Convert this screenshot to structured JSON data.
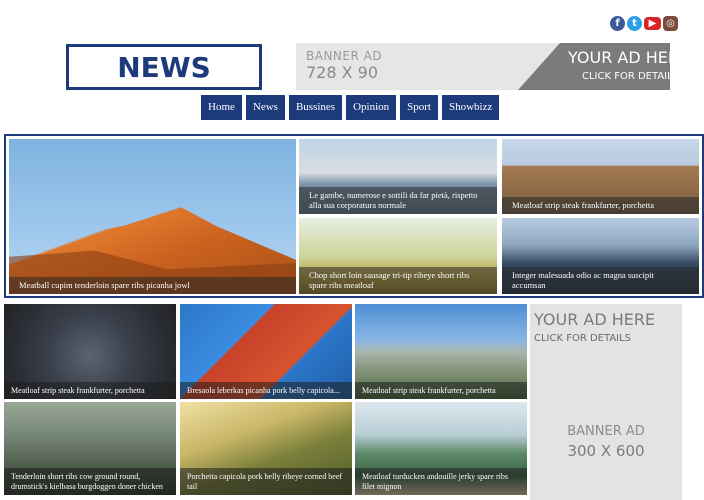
{
  "social": [
    {
      "name": "facebook",
      "glyph": "f"
    },
    {
      "name": "twitter",
      "glyph": "t"
    },
    {
      "name": "youtube",
      "glyph": "▶"
    },
    {
      "name": "instagram",
      "glyph": "◎"
    }
  ],
  "logo": {
    "text": "NEWS"
  },
  "banner_top": {
    "label": "BANNER AD",
    "size": "728 X 90",
    "cta_title": "YOUR AD HERE",
    "cta_sub": "CLICK FOR DETAILS"
  },
  "nav": [
    "Home",
    "News",
    "Bussines",
    "Opinion",
    "Sport",
    "Showbizz"
  ],
  "featured": [
    "Meatball cupim tenderloin spare ribs picanha jowl",
    "Le gambe, numerose e sottili da far pietà, rispetto alla sua corporatura normale",
    "Meatloaf strip steak frankfurter, porchetta",
    "Chop short loin sausage tri-tip ribeye short ribs spare ribs meatloaf",
    "Integer malesuada odio ac magna suscipit accumsan"
  ],
  "grid": [
    "Meatloaf strip steak frankfurter, porchetta",
    "Bresaola leberkas picanha pork belly capicola...",
    "Meatloaf strip steak frankfurter, porchetta",
    "Tenderloin short ribs cow ground round, drumstick's kielbasa burgdoggen doner chicken",
    "Porchetta capicola pork belly ribeye corned beef tail",
    "Meatloaf turducken andouille jerky spare ribs filet mignon"
  ],
  "side_ad": {
    "cta_title": "YOUR AD HERE",
    "cta_sub": "CLICK FOR DETAILS",
    "label": "BANNER AD",
    "size": "300 X 600"
  }
}
